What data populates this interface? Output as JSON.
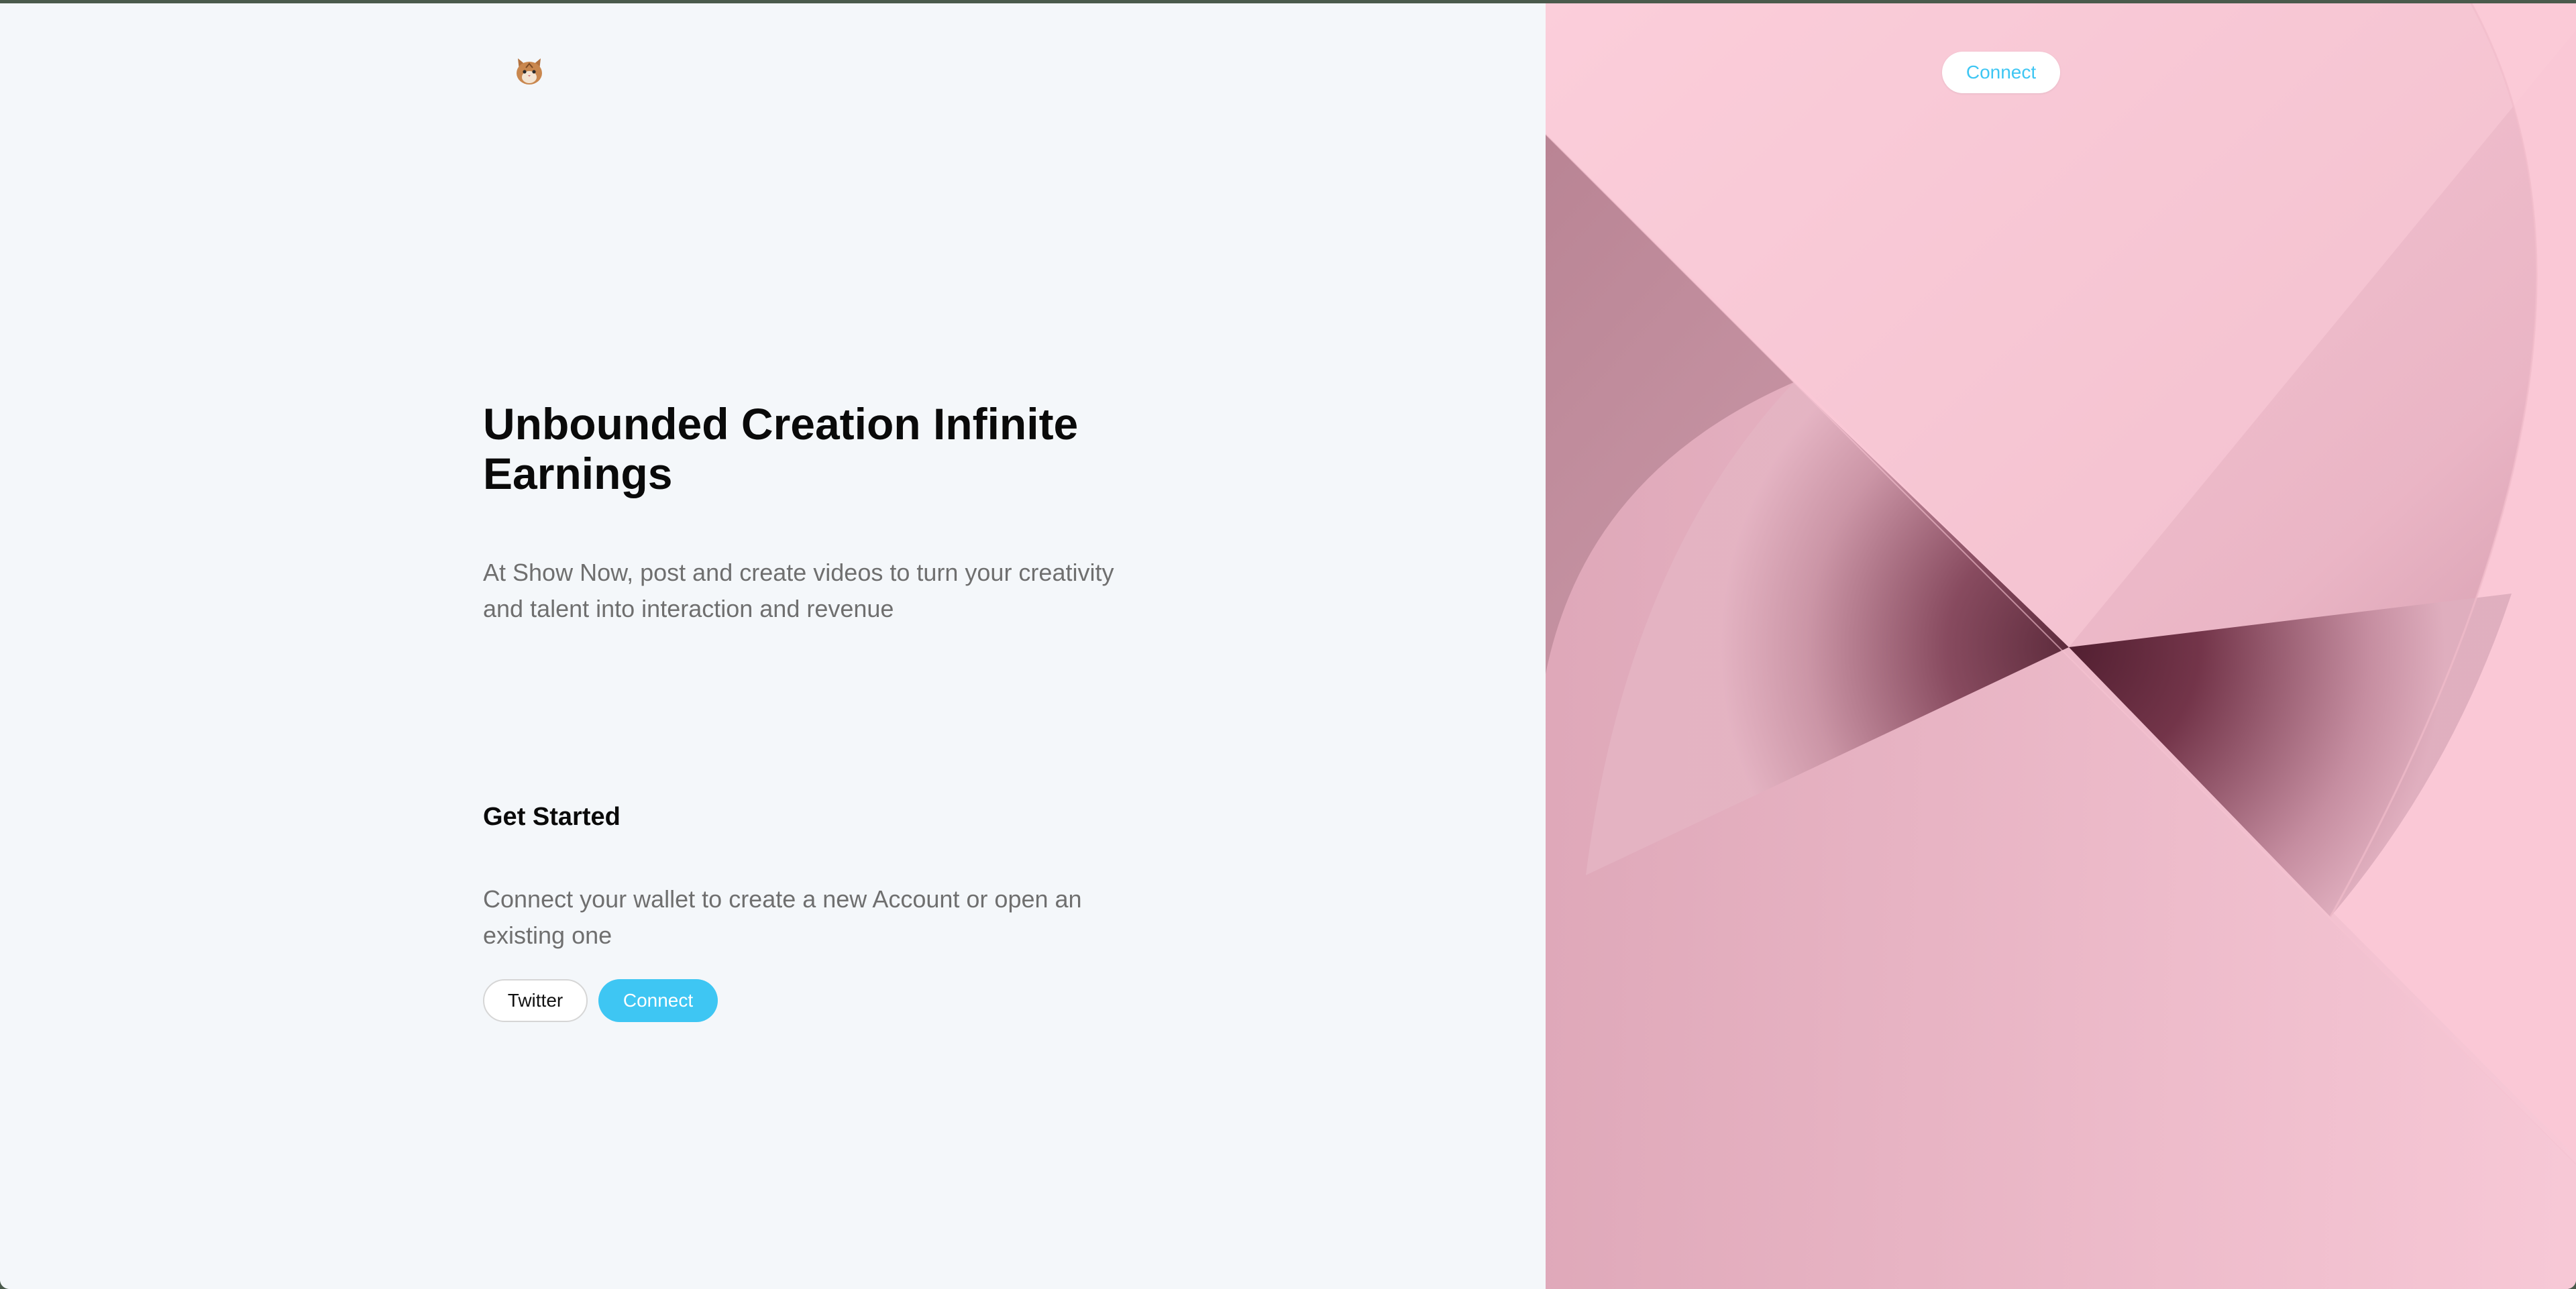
{
  "header": {
    "logo_icon": "cat-face-icon",
    "connect_label": "Connect"
  },
  "hero": {
    "title": "Unbounded Creation Infinite Earnings",
    "subtitle": "At Show Now, post and create videos to turn your creativity and talent into interaction and revenue"
  },
  "get_started": {
    "title": "Get Started",
    "description": "Connect your wallet to create a new Account or open an existing one",
    "twitter_label": "Twitter",
    "connect_label": "Connect"
  },
  "colors": {
    "accent": "#3ec6f3",
    "panel_pink": "#fac8d6",
    "dark_wine": "#5a2436"
  }
}
